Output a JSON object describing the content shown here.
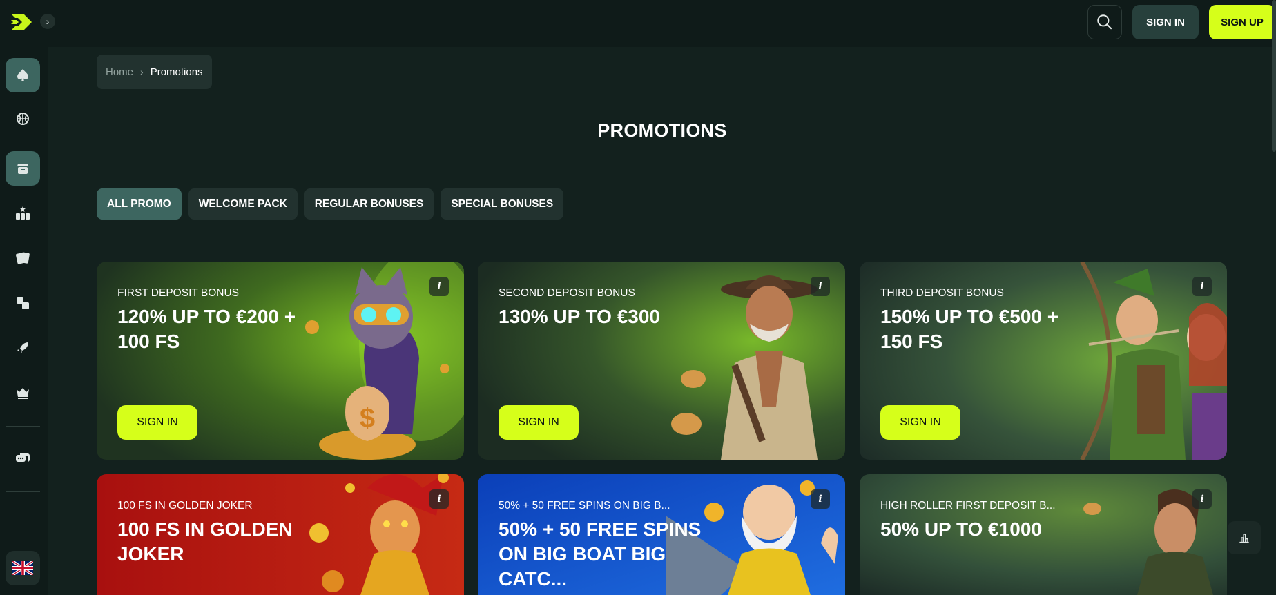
{
  "header": {
    "sign_in_label": "SIGN IN",
    "sign_up_label": "SIGN UP",
    "search_icon": "search-icon"
  },
  "sidebar": {
    "items": [
      {
        "name": "casino",
        "icon": "spade-icon",
        "active": true
      },
      {
        "name": "sports",
        "icon": "basketball-icon"
      },
      {
        "name": "promotions",
        "icon": "gift-shop-icon",
        "active": true
      },
      {
        "name": "slots",
        "icon": "slots-777-icon"
      },
      {
        "name": "cards",
        "icon": "playing-cards-icon"
      },
      {
        "name": "table-games",
        "icon": "table-games-icon"
      },
      {
        "name": "crash",
        "icon": "rocket-icon"
      },
      {
        "name": "vip",
        "icon": "crown-icon"
      },
      {
        "name": "support",
        "icon": "chat-icon"
      }
    ],
    "language": "gb-flag-icon"
  },
  "breadcrumb": {
    "home": "Home",
    "current": "Promotions"
  },
  "page_title": "PROMOTIONS",
  "tabs": [
    {
      "label": "ALL PROMO",
      "active": true
    },
    {
      "label": "WELCOME PACK"
    },
    {
      "label": "REGULAR BONUSES"
    },
    {
      "label": "SPECIAL BONUSES"
    }
  ],
  "cards": [
    {
      "label": "FIRST DEPOSIT BONUS",
      "title": "120% UP TO €200 + 100 FS",
      "button": "SIGN IN",
      "art": "cat-with-money-bag"
    },
    {
      "label": "SECOND DEPOSIT BONUS",
      "title": "130% UP TO €300",
      "button": "SIGN IN",
      "art": "cowboy-explorer"
    },
    {
      "label": "THIRD DEPOSIT BONUS",
      "title": "150% UP TO €500 + 150 FS",
      "button": "SIGN IN",
      "art": "archer-hero"
    },
    {
      "label": "100 FS IN GOLDEN JOKER",
      "title": "100 FS IN GOLDEN JOKER",
      "art": "jester"
    },
    {
      "label": "50% + 50 FREE SPINS ON BIG B...",
      "title": "50% + 50 FREE SPINS ON BIG BOAT BIG CATC...",
      "art": "fisherman"
    },
    {
      "label": "HIGH ROLLER FIRST DEPOSIT B...",
      "title": "50% UP TO €1000",
      "art": "adventurer"
    }
  ],
  "colors": {
    "accent": "#d6ff1a",
    "background": "#13211e",
    "sidebar": "#0f1b19",
    "active_tab": "#3d6660"
  }
}
